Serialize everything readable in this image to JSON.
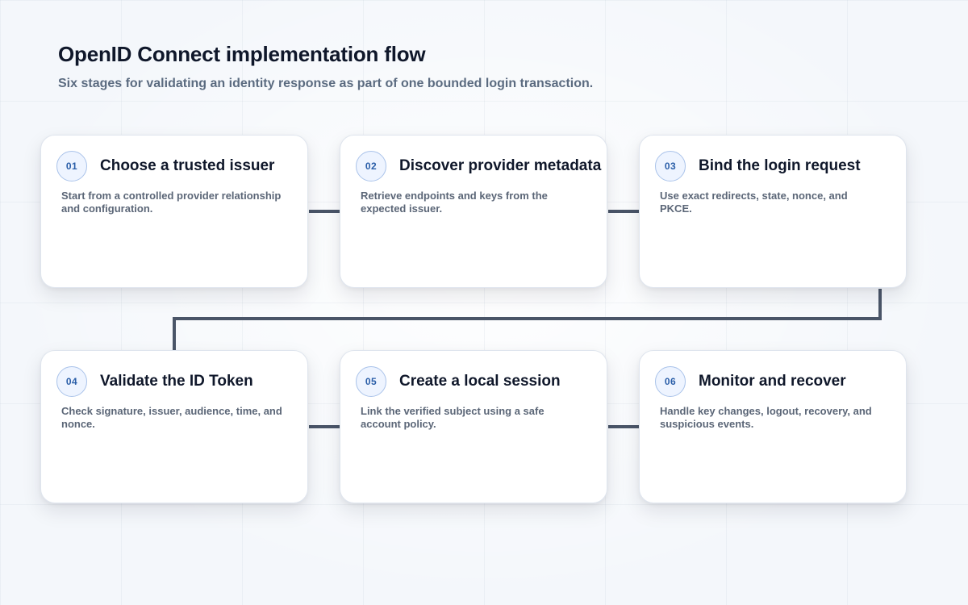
{
  "header": {
    "title": "OpenID Connect implementation flow",
    "subtitle": "Six stages for validating an identity response as part of one bounded login transaction."
  },
  "colors": {
    "connector": "#4a5568",
    "badge_text": "#2a5ea8",
    "badge_border": "#aac3ea",
    "badge_fill": "#eef4ff",
    "card_fill": "#ffffff",
    "background": "#f4f7fb"
  },
  "stages": [
    {
      "number": "01",
      "title": "Choose a trusted issuer",
      "description": "Start from a controlled provider relationship and configuration."
    },
    {
      "number": "02",
      "title": "Discover provider metadata",
      "description": "Retrieve endpoints and keys from the expected issuer."
    },
    {
      "number": "03",
      "title": "Bind the login request",
      "description": "Use exact redirects, state, nonce, and PKCE."
    },
    {
      "number": "04",
      "title": "Validate the ID Token",
      "description": "Check signature, issuer, audience, time, and nonce."
    },
    {
      "number": "05",
      "title": "Create a local session",
      "description": "Link the verified subject using a safe account policy."
    },
    {
      "number": "06",
      "title": "Monitor and recover",
      "description": "Handle key changes, logout, recovery, and suspicious events."
    }
  ]
}
